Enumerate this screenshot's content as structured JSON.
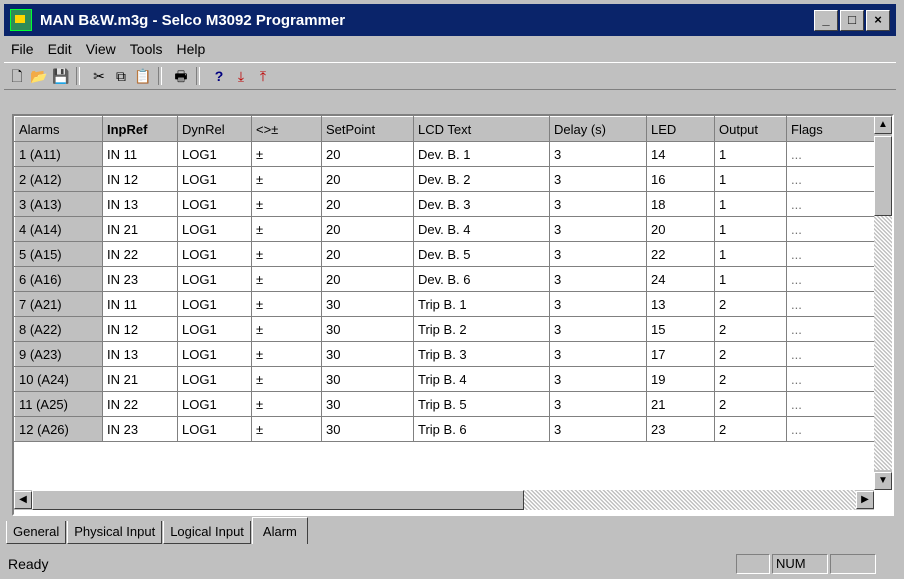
{
  "window": {
    "title": "MAN B&W.m3g - Selco M3092 Programmer",
    "buttons": [
      "_",
      "□",
      "×"
    ]
  },
  "menu": [
    "File",
    "Edit",
    "View",
    "Tools",
    "Help"
  ],
  "toolbar": {
    "icons": [
      "new-icon",
      "open-icon",
      "save-icon",
      "cut-icon",
      "copy-icon",
      "paste-icon",
      "print-icon",
      "help-icon",
      "download-icon",
      "upload-icon"
    ],
    "glyphs": {
      "new": "🗋",
      "open": "📂",
      "save": "💾",
      "cut": "✂",
      "copy": "⧉",
      "paste": "📋",
      "print": "🖶",
      "help": "?",
      "download": "⤓",
      "upload": "⤒"
    }
  },
  "grid": {
    "columns": [
      "Alarms",
      "InpRef",
      "DynRel",
      "<>±",
      "SetPoint",
      "LCD Text",
      "Delay (s)",
      "LED",
      "Output",
      "Flags"
    ],
    "rows": [
      [
        "1 (A11)",
        "IN 11",
        "LOG1",
        "±",
        "20",
        "Dev. B. 1",
        "3",
        "14",
        "1",
        "..."
      ],
      [
        "2 (A12)",
        "IN 12",
        "LOG1",
        "±",
        "20",
        "Dev. B. 2",
        "3",
        "16",
        "1",
        "..."
      ],
      [
        "3 (A13)",
        "IN 13",
        "LOG1",
        "±",
        "20",
        "Dev. B. 3",
        "3",
        "18",
        "1",
        "..."
      ],
      [
        "4 (A14)",
        "IN 21",
        "LOG1",
        "±",
        "20",
        "Dev. B. 4",
        "3",
        "20",
        "1",
        "..."
      ],
      [
        "5 (A15)",
        "IN 22",
        "LOG1",
        "±",
        "20",
        "Dev. B. 5",
        "3",
        "22",
        "1",
        "..."
      ],
      [
        "6 (A16)",
        "IN 23",
        "LOG1",
        "±",
        "20",
        "Dev. B. 6",
        "3",
        "24",
        "1",
        "..."
      ],
      [
        "7 (A21)",
        "IN 11",
        "LOG1",
        "±",
        "30",
        "Trip B. 1",
        "3",
        "13",
        "2",
        "..."
      ],
      [
        "8 (A22)",
        "IN 12",
        "LOG1",
        "±",
        "30",
        "Trip B. 2",
        "3",
        "15",
        "2",
        "..."
      ],
      [
        "9 (A23)",
        "IN 13",
        "LOG1",
        "±",
        "30",
        "Trip B. 3",
        "3",
        "17",
        "2",
        "..."
      ],
      [
        "10 (A24)",
        "IN 21",
        "LOG1",
        "±",
        "30",
        "Trip B. 4",
        "3",
        "19",
        "2",
        "..."
      ],
      [
        "11 (A25)",
        "IN 22",
        "LOG1",
        "±",
        "30",
        "Trip B. 5",
        "3",
        "21",
        "2",
        "..."
      ],
      [
        "12 (A26)",
        "IN 23",
        "LOG1",
        "±",
        "30",
        "Trip B. 6",
        "3",
        "23",
        "2",
        "..."
      ]
    ]
  },
  "scroll": {
    "up": "▲",
    "down": "▼",
    "left": "◀",
    "right": "▶"
  },
  "tabs": [
    "General",
    "Physical Input",
    "Logical Input",
    "Alarm"
  ],
  "status": {
    "text": "Ready",
    "num": "NUM"
  }
}
